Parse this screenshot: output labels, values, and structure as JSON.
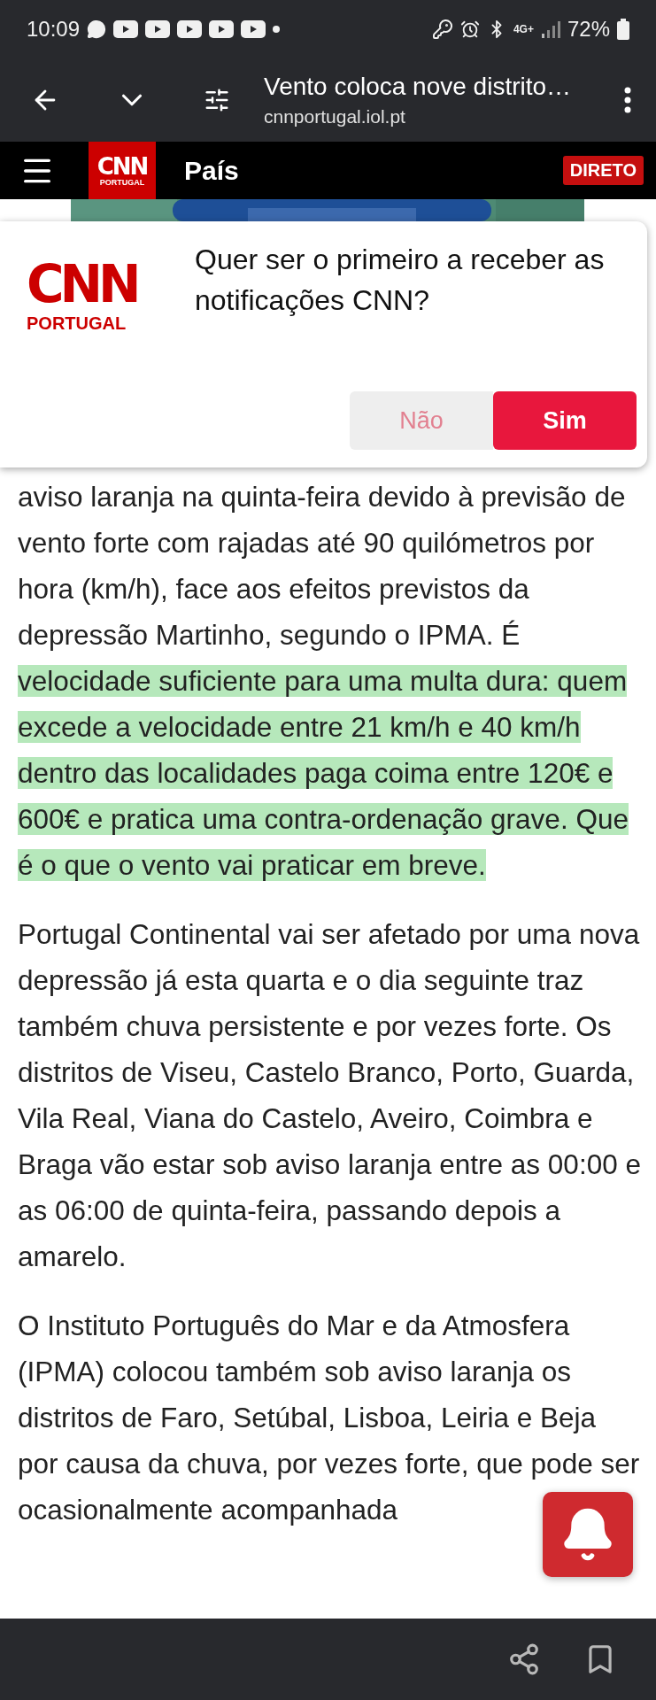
{
  "status_bar": {
    "time": "10:09",
    "network": "4G+",
    "battery": "72%"
  },
  "browser": {
    "page_title": "Vento coloca nove distrito…",
    "url": "cnnportugal.iol.pt"
  },
  "site_header": {
    "logo": {
      "brand": "CNN",
      "sub": "PORTUGAL"
    },
    "section": "País",
    "live_badge": "DIRETO"
  },
  "popup": {
    "logo": {
      "brand": "CNN",
      "sub": "PORTUGAL"
    },
    "question": "Quer ser o primeiro a receber as notificações CNN?",
    "buttons": [
      {
        "label": "Não",
        "kind": "secondary"
      },
      {
        "label": "Sim",
        "kind": "primary"
      }
    ]
  },
  "article": {
    "paragraphs": [
      {
        "segments": [
          {
            "text": "aviso laranja na quinta-feira devido à previsão de vento forte com rajadas até 90 quilómetros por hora (km/h), face aos efeitos previstos da depressão Martinho, segundo o IPMA. É ",
            "highlighted": false
          },
          {
            "text": "velocidade suficiente para uma multa dura: quem excede a velocidade entre 21 km/h e 40 km/h dentro das localidades paga coima entre 120€ e 600€ e pratica uma contra-ordenação grave. Que é o que o vento vai praticar em breve.",
            "highlighted": true
          }
        ]
      },
      {
        "segments": [
          {
            "text": "Portugal Continental vai ser afetado por uma nova depressão já esta quarta e o dia seguinte traz também chuva persistente e por vezes forte. Os distritos de Viseu, Castelo Branco, Porto, Guarda, Vila Real, Viana do Castelo, Aveiro, Coimbra e Braga vão estar sob aviso laranja entre as 00:00 e as 06:00 de quinta-feira, passando depois a amarelo.",
            "highlighted": false
          }
        ]
      },
      {
        "segments": [
          {
            "text": "O Instituto Português do Mar e da Atmosfera (IPMA) colocou também sob aviso laranja os distritos de Faro, Setúbal, Lisboa, Leiria e Beja por causa da chuva, por vezes forte, que pode ser ocasionalmente acompanhada",
            "highlighted": false
          }
        ]
      }
    ]
  }
}
